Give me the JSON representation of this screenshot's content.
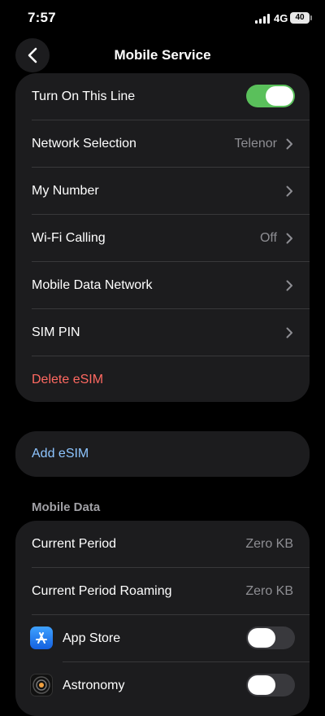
{
  "status": {
    "time": "7:57",
    "network": "4G",
    "battery": "40"
  },
  "nav": {
    "title": "Mobile Service"
  },
  "line_group": {
    "turn_on_label": "Turn On This Line",
    "turn_on_state": true,
    "rows": [
      {
        "label": "Network Selection",
        "value": "Telenor"
      },
      {
        "label": "My Number",
        "value": ""
      },
      {
        "label": "Wi-Fi Calling",
        "value": "Off"
      },
      {
        "label": "Mobile Data Network",
        "value": ""
      },
      {
        "label": "SIM PIN",
        "value": ""
      }
    ],
    "delete_label": "Delete eSIM"
  },
  "add_esim": {
    "label": "Add eSIM"
  },
  "mobile_data": {
    "header": "Mobile Data",
    "current_period": {
      "label": "Current Period",
      "value": "Zero KB"
    },
    "current_period_roaming": {
      "label": "Current Period Roaming",
      "value": "Zero KB"
    },
    "apps": [
      {
        "label": "App Store",
        "icon": "app-store-icon",
        "enabled": false
      },
      {
        "label": "Astronomy",
        "icon": "astronomy-icon",
        "enabled": false
      }
    ]
  },
  "colors": {
    "accent_green": "#5ac05b",
    "destructive": "#ff6961",
    "link": "#8ec5ff"
  }
}
